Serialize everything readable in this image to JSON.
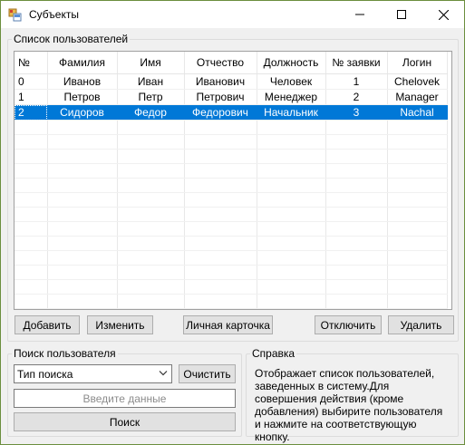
{
  "window": {
    "title": "Субъекты"
  },
  "users_group": {
    "label": "Список пользователей",
    "columns": [
      "№",
      "Фамилия",
      "Имя",
      "Отчество",
      "Должность",
      "№ заявки",
      "Логин"
    ],
    "rows": [
      [
        "0",
        "Иванов",
        "Иван",
        "Иванович",
        "Человек",
        "1",
        "Chelovek"
      ],
      [
        "1",
        "Петров",
        "Петр",
        "Петрович",
        "Менеджер",
        "2",
        "Manager"
      ],
      [
        "2",
        "Сидоров",
        "Федор",
        "Федорович",
        "Начальник",
        "3",
        "Nachal"
      ]
    ],
    "selected_row": 2,
    "buttons": {
      "add": "Добавить",
      "edit": "Изменить",
      "card": "Личная карточка",
      "disable": "Отключить",
      "delete": "Удалить"
    }
  },
  "search_group": {
    "label": "Поиск пользователя",
    "search_type": "Тип поиска",
    "clear": "Очистить",
    "input_placeholder": "Введите данные",
    "search": "Поиск"
  },
  "help_group": {
    "label": "Справка",
    "text": "Отображает список пользователей, заведенных в систему.Для совершения действия (кроме добавления) выбирите пользователя и нажмите на соответствующую кнопку."
  },
  "colors": {
    "selection": "#0078d7",
    "window_border": "#6b8e3e"
  }
}
